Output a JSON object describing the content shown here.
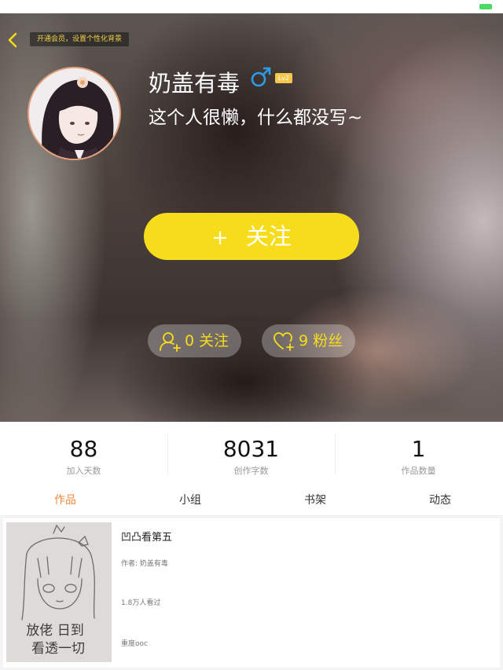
{
  "profile": {
    "vip_hint": "开通会员，设置个性化背景",
    "username": "奶盖有毒",
    "gender_symbol": "♂",
    "level": "Lv2",
    "signature": "这个人很懒，什么都没写~",
    "follow_plus": "+",
    "follow_label": "关注",
    "following_text": "0 关注",
    "fans_text": "9 粉丝"
  },
  "stats": [
    {
      "value": "88",
      "label": "加入天数"
    },
    {
      "value": "8031",
      "label": "创作字数"
    },
    {
      "value": "1",
      "label": "作品数量"
    }
  ],
  "tabs": [
    {
      "label": "作品",
      "active": true
    },
    {
      "label": "小组",
      "active": false
    },
    {
      "label": "书架",
      "active": false
    },
    {
      "label": "动态",
      "active": false
    }
  ],
  "works": [
    {
      "title": "凹凸看第五",
      "author": "作者: 奶盖有毒",
      "views": "1.8万人看过",
      "tag": "重度ooc",
      "cover_text": [
        "放佬 日到",
        "看透一切"
      ]
    }
  ],
  "colors": {
    "accent_yellow": "#f7dc1b",
    "active_tab": "#f08a3c",
    "gender_blue": "#2e9be8",
    "battery_green": "#4cd964"
  }
}
